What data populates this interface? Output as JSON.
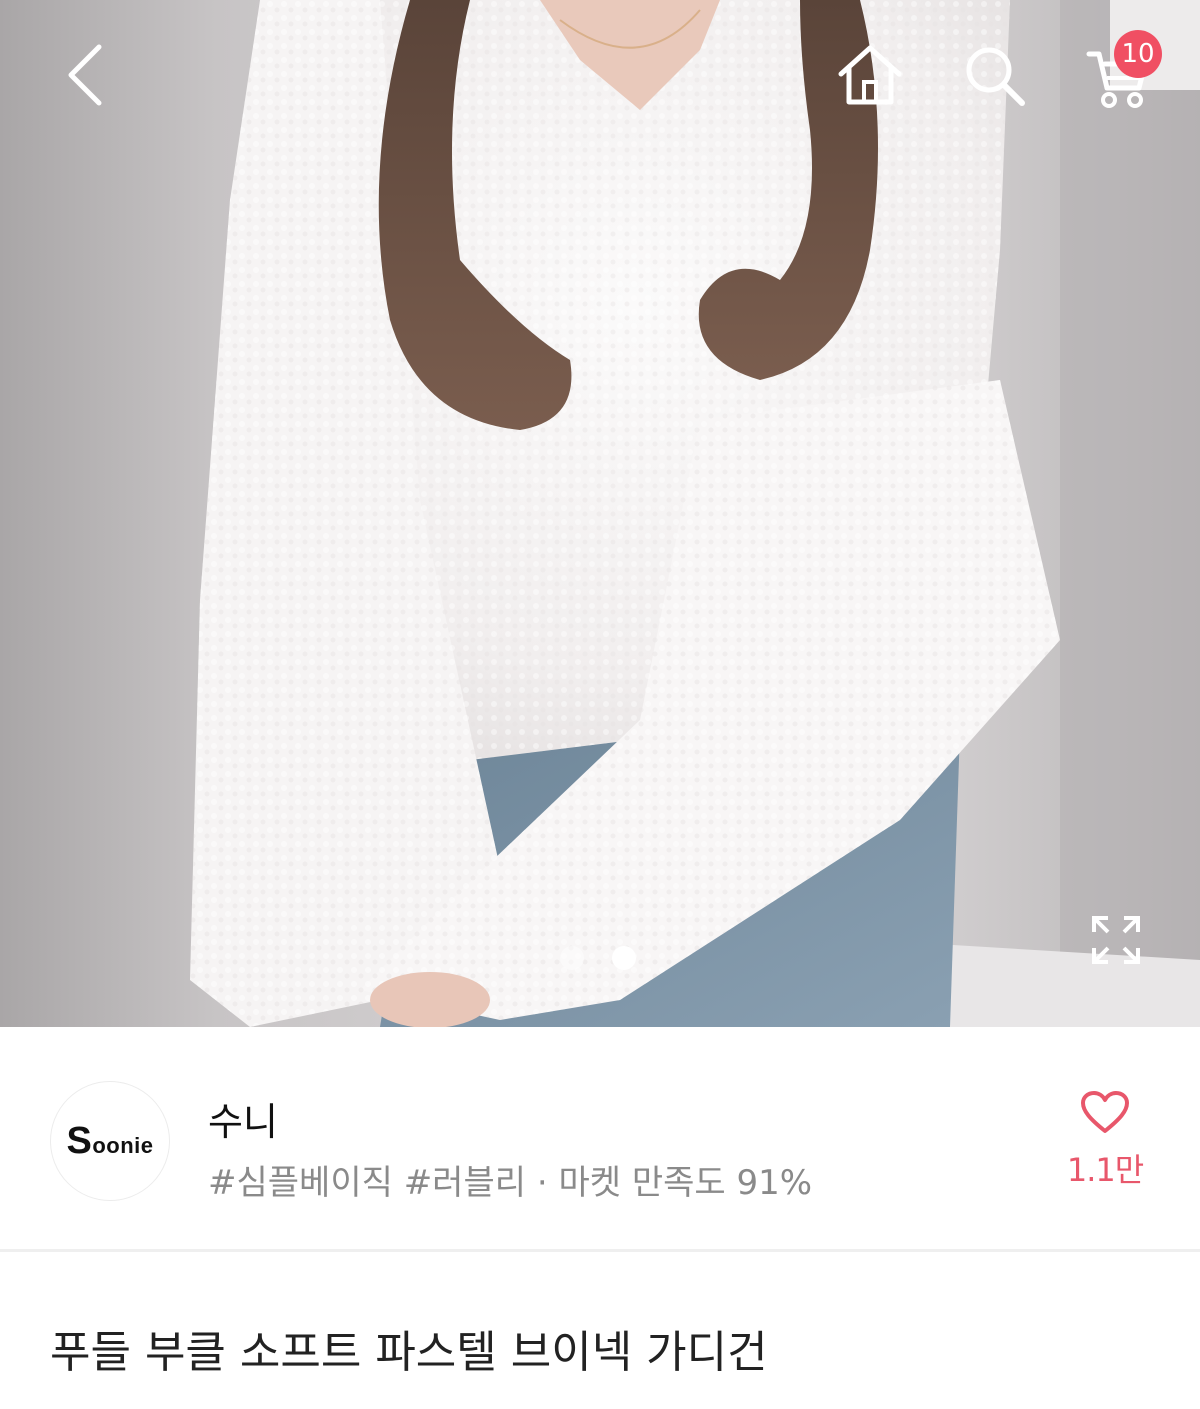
{
  "topbar": {
    "back_icon": "chevron-left-icon",
    "home_icon": "home-icon",
    "search_icon": "search-icon",
    "cart_icon": "cart-icon",
    "cart_count": "10",
    "badge_color": "#f04f63"
  },
  "gallery": {
    "image_description": "product-photo",
    "total_slides": 2,
    "active_slide": 2,
    "expand_icon": "expand-icon"
  },
  "seller": {
    "logo_text_initial": "S",
    "logo_text_rest": "oonie",
    "name": "수니",
    "meta": "#심플베이직 #러블리 · 마켓 만족도 91%",
    "like_icon": "heart-icon",
    "like_count": "1.1만",
    "accent_color": "#e8576b"
  },
  "product": {
    "title": "푸들 부클 소프트 파스텔 브이넥 가디건"
  }
}
